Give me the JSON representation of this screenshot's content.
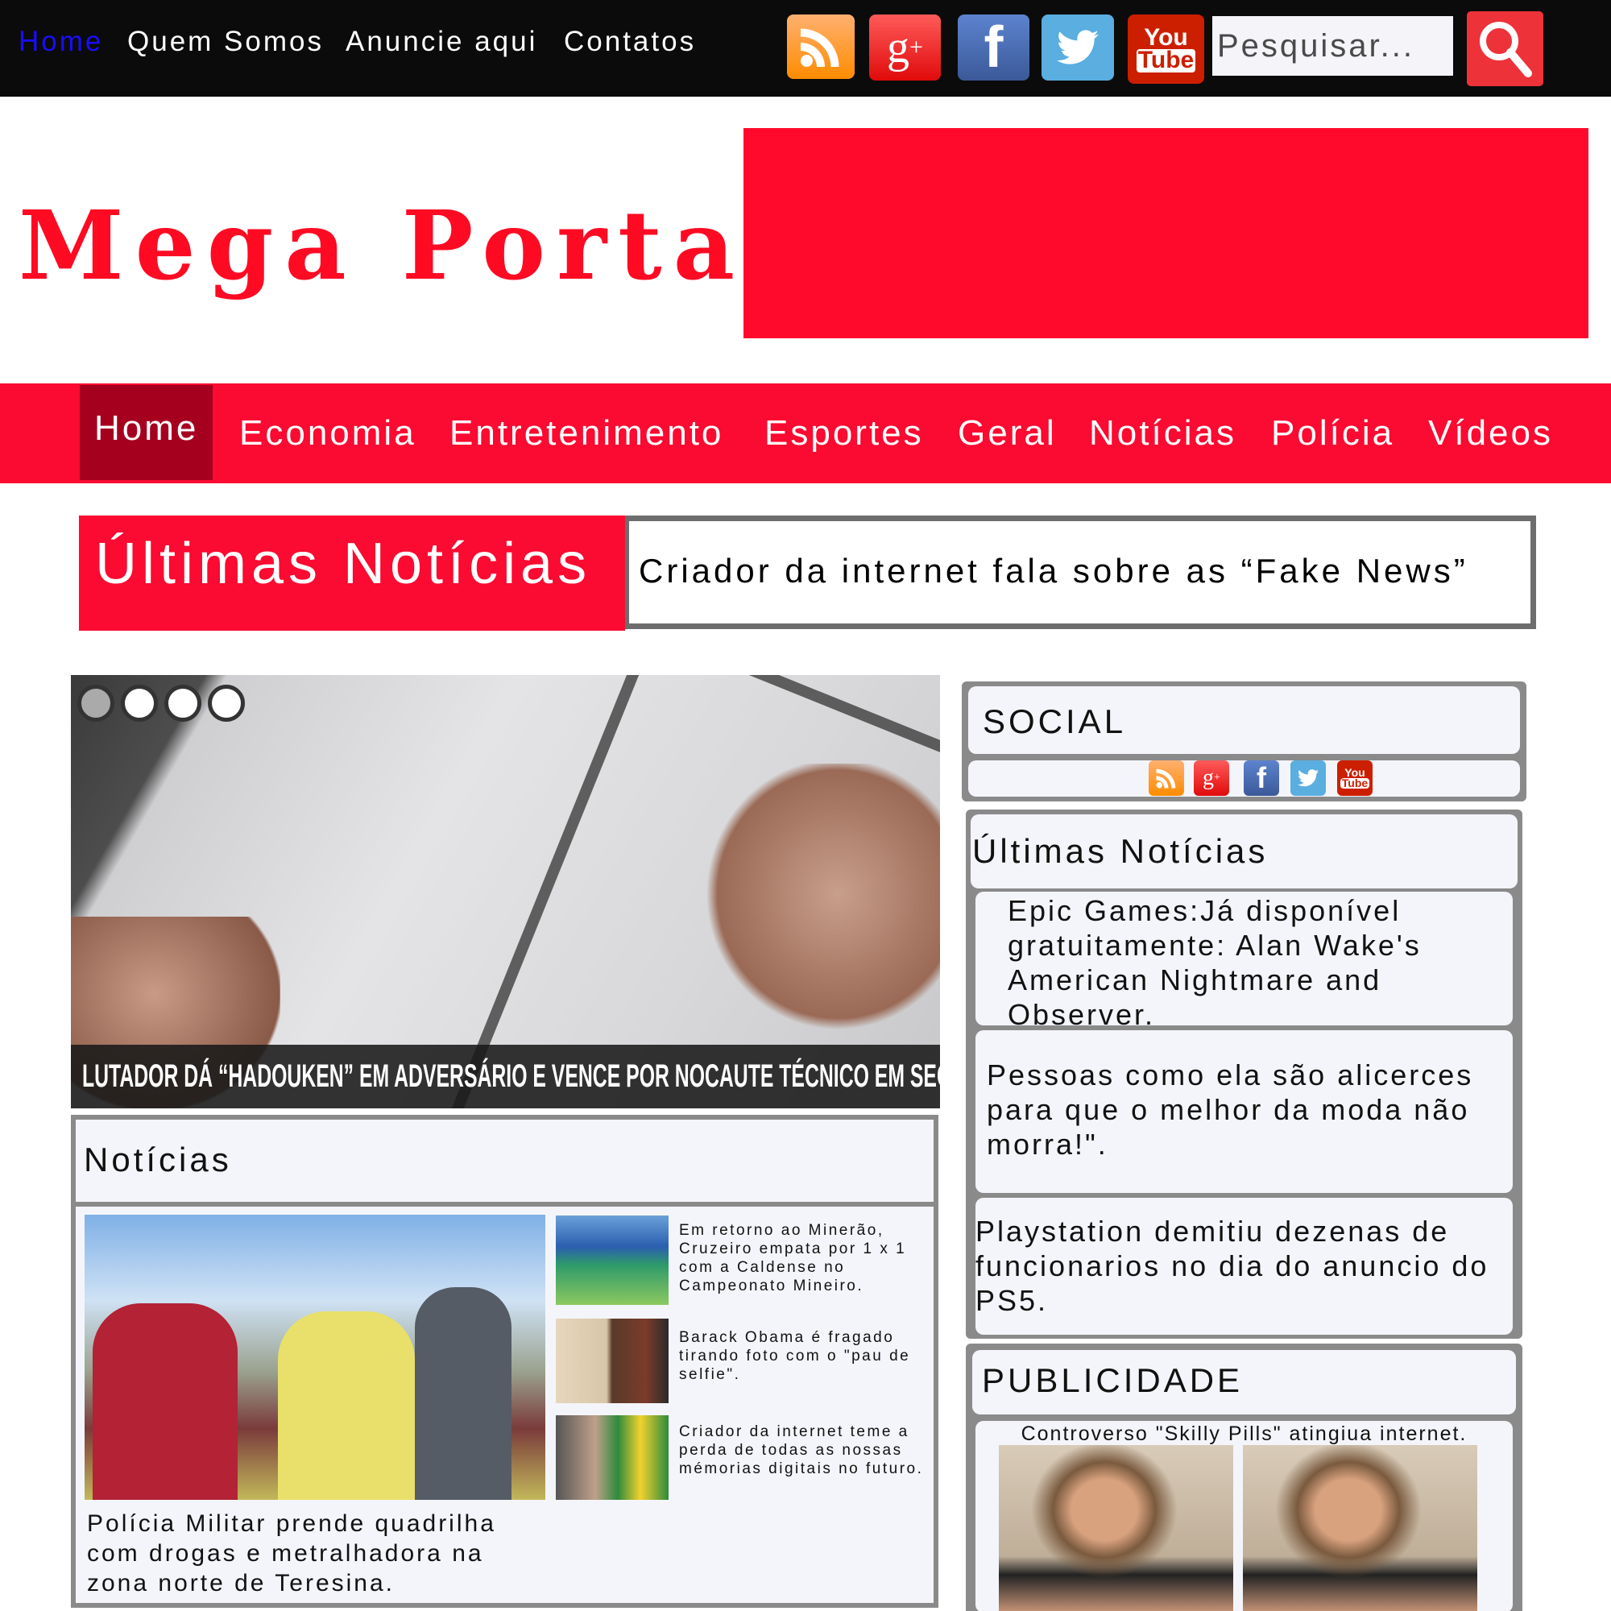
{
  "topbar": {
    "links": [
      "Home",
      "Quem Somos",
      "Anuncie aqui",
      "Contatos"
    ],
    "active_color": "#1a0dff",
    "social_icons": [
      "rss-icon",
      "google-plus-icon",
      "facebook-icon",
      "twitter-icon",
      "youtube-icon"
    ],
    "search_placeholder": "Pesquisar...",
    "youtube_you": "You",
    "youtube_tube": "Tube"
  },
  "header": {
    "logo": "Mega Portal",
    "brand_color": "#ff0a23"
  },
  "nav": {
    "items": [
      "Home",
      "Economia",
      "Entretenimento",
      "Esportes",
      "Geral",
      "Notícias",
      "Polícia",
      "Vídeos"
    ]
  },
  "ticker": {
    "label": "Últimas Notícias",
    "headline": "Criador da internet fala sobre as “Fake News”"
  },
  "slider": {
    "caption": "LUTADOR DÁ “HADOUKEN” EM ADVERSÁRIO E VENCE POR NOCAUTE TÉCNICO EM SEGUIDA",
    "slide_count": 4,
    "active_slide": 1
  },
  "noticias": {
    "title": "Notícias",
    "main_caption": "Polícia Militar prende quadrilha com drogas e metralhadora na zona norte de Teresina.",
    "items": [
      "Em retorno ao Minerão, Cruzeiro empata por 1 x 1 com a Caldense no Campeonato Mineiro.",
      "Barack Obama é fragado tirando foto com o \"pau de selfie\".",
      "Criador da internet teme a perda de todas as nossas mémorias digitais no futuro."
    ]
  },
  "sidebar": {
    "social_title": "SOCIAL",
    "latest_title": "Últimas Notícias",
    "latest_items": [
      "Epic Games:Já disponível gratuitamente: Alan Wake's American Nightmare and Observer.",
      "Pessoas como ela são alicerces para que o melhor da moda não morra!\".",
      "Playstation demitiu dezenas de funcionarios no dia do anuncio do PS5."
    ],
    "ad_title": "PUBLICIDADE",
    "ad_caption": "Controverso \"Skilly Pills\" atingiua internet."
  }
}
